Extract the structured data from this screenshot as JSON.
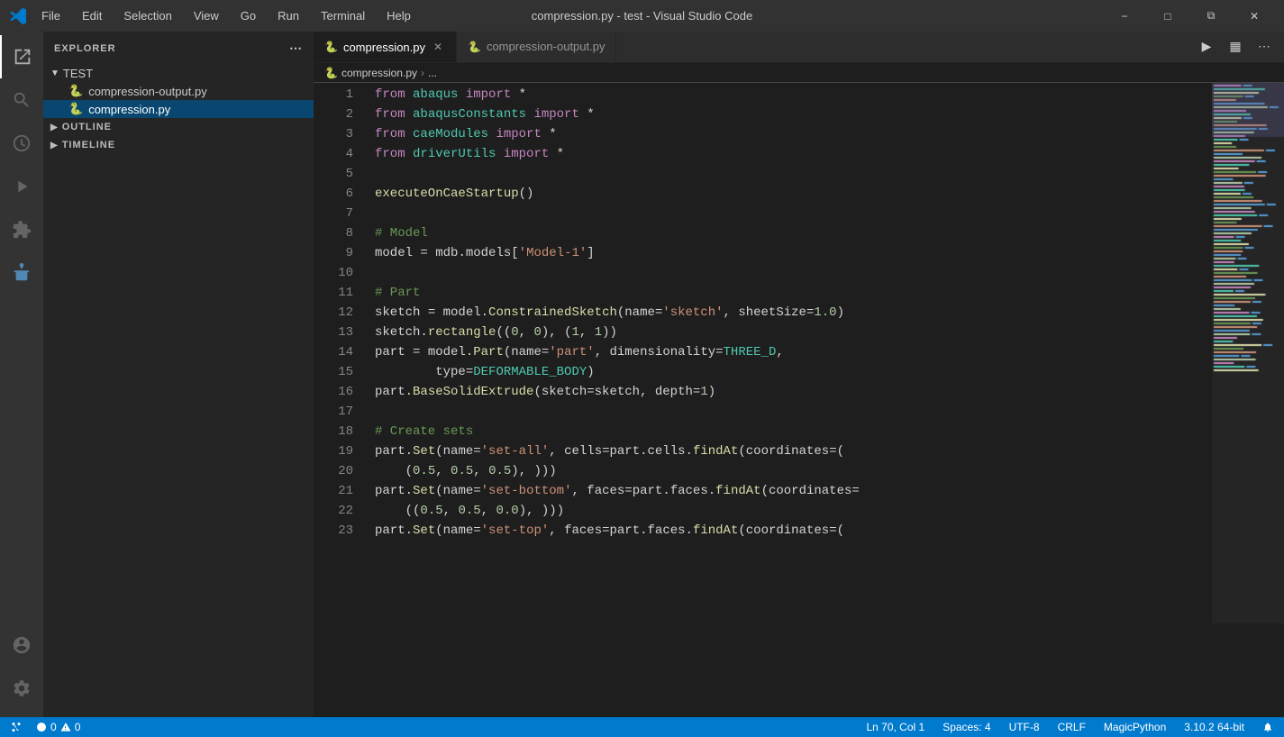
{
  "titlebar": {
    "title": "compression.py - test - Visual Studio Code",
    "menu_items": [
      "File",
      "Edit",
      "Selection",
      "View",
      "Go",
      "Run",
      "Terminal",
      "Help"
    ]
  },
  "tabs": [
    {
      "label": "compression.py",
      "active": true,
      "icon": "🐍"
    },
    {
      "label": "compression-output.py",
      "active": false,
      "icon": "🐍"
    }
  ],
  "breadcrumb": {
    "file": "compression.py",
    "sep": "›",
    "rest": "..."
  },
  "sidebar": {
    "title": "EXPLORER",
    "folder": "TEST",
    "files": [
      {
        "name": "compression-output.py",
        "active": false
      },
      {
        "name": "compression.py",
        "active": true
      }
    ],
    "sections": [
      "OUTLINE",
      "TIMELINE"
    ]
  },
  "status": {
    "errors": "0",
    "warnings": "0",
    "position": "Ln 70, Col 1",
    "spaces": "Spaces: 4",
    "encoding": "UTF-8",
    "eol": "CRLF",
    "language": "MagicPython",
    "version": "3.10.2 64-bit"
  },
  "code_lines": [
    {
      "num": 1,
      "content": "from abaqus import *"
    },
    {
      "num": 2,
      "content": "from abaqusConstants import *"
    },
    {
      "num": 3,
      "content": "from caeModules import *"
    },
    {
      "num": 4,
      "content": "from driverUtils import *"
    },
    {
      "num": 5,
      "content": ""
    },
    {
      "num": 6,
      "content": "executeOnCaeStartup()"
    },
    {
      "num": 7,
      "content": ""
    },
    {
      "num": 8,
      "content": "# Model"
    },
    {
      "num": 9,
      "content": "model = mdb.models['Model-1']"
    },
    {
      "num": 10,
      "content": ""
    },
    {
      "num": 11,
      "content": "# Part"
    },
    {
      "num": 12,
      "content": "sketch = model.ConstrainedSketch(name='sketch', sheetSize=1.0)"
    },
    {
      "num": 13,
      "content": "sketch.rectangle((0, 0), (1, 1))"
    },
    {
      "num": 14,
      "content": "part = model.Part(name='part', dimensionality=THREE_D,"
    },
    {
      "num": 15,
      "content": "    type=DEFORMABLE_BODY)"
    },
    {
      "num": 16,
      "content": "part.BaseSolidExtrude(sketch=sketch, depth=1)"
    },
    {
      "num": 17,
      "content": ""
    },
    {
      "num": 18,
      "content": "# Create sets"
    },
    {
      "num": 19,
      "content": "part.Set(name='set-all', cells=part.cells.findAt(coordinates=("
    },
    {
      "num": 20,
      "content": "    (0.5, 0.5, 0.5), )))"
    },
    {
      "num": 21,
      "content": "part.Set(name='set-bottom', faces=part.faces.findAt(coordinates="
    },
    {
      "num": 22,
      "content": "    ((0.5, 0.5, 0.0), )))"
    },
    {
      "num": 23,
      "content": "part.Set(name='set-top', faces=part.faces.findAt(coordinates=("
    }
  ]
}
